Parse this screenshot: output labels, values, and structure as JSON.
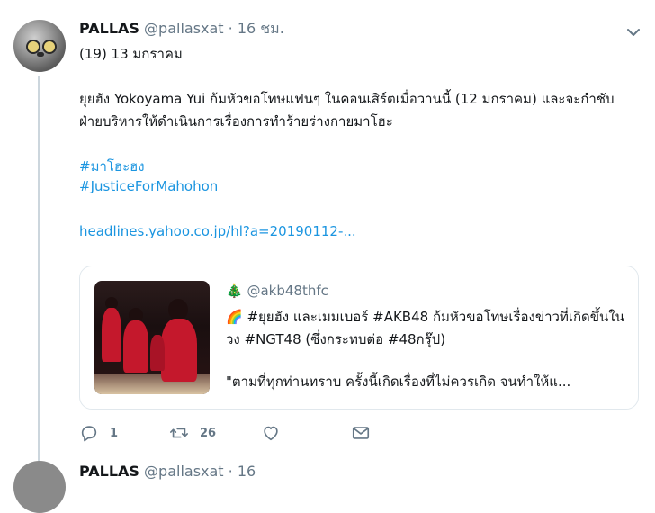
{
  "tweet": {
    "display_name": "PALLAS",
    "handle": "@pallasxat",
    "dot": "·",
    "time": "16 ชม.",
    "subline": "(19) 13 มกราคม",
    "body": "ยุยฮัง Yokoyama Yui ก้มหัวขอโทษแฟนๆ ในคอนเสิร์ตเมื่อวานนี้ (12 มกราคม) และจะกำชับฝ่ายบริหารให้ดำเนินการเรื่องการทำร้ายร่างกายมาโฮะ",
    "hashtag_1": "#มาโฮะฮง",
    "hashtag_2": "#JusticeForMahohon",
    "url": "headlines.yahoo.co.jp/hl?a=20190112-..."
  },
  "quoted": {
    "emoji": "🎄",
    "handle": "@akb48thfc",
    "text": "🌈 #ยุยฮัง และเมมเบอร์ #AKB48 ก้มหัวขอโทษเรื่องข่าวที่เกิดขึ้นในวง #NGT48 (ซึ่งกระทบต่อ #48กรุ๊ป)",
    "quote": "\"ตามที่ทุกท่านทราบ ครั้งนี้เกิดเรื่องที่ไม่ควรเกิด จนทำให้แ..."
  },
  "actions": {
    "reply_count": "1",
    "retweet_count": "26",
    "like_count": "",
    "icons": [
      "reply-icon",
      "retweet-icon",
      "like-icon",
      "direct-message-icon"
    ]
  },
  "next_tweet": {
    "display_name": "PALLAS",
    "rest": "@pallasxat · 16"
  },
  "colors": {
    "link": "#1b95e0",
    "muted": "#657786",
    "border": "#e1e8ed"
  }
}
